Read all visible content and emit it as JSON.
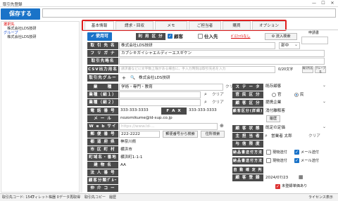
{
  "window": {
    "title": "取引先登録",
    "minimize": "—",
    "maximize": "☐",
    "close": "✕"
  },
  "toolbar": {
    "save_label": "保存する"
  },
  "tree": {
    "items": [
      {
        "label": "選択先",
        "color": "red"
      },
      {
        "label": "　株式会社LDS技研",
        "color": "black"
      },
      {
        "label": "グループ",
        "color": "blue"
      },
      {
        "label": "　株式会社LDS技研",
        "color": "black"
      }
    ]
  },
  "tabs": [
    "基本情報",
    "請求・回収",
    "メモ",
    "ご担当者",
    "購買",
    "オプション"
  ],
  "form": {
    "status_btn": "使用可",
    "usage_label": "利 用 区 分",
    "customer_label": "顧客",
    "supplier_label": "仕入先",
    "profile_link": "ｶﾞﾛﾌｧｲﾙなし",
    "tail_search": "流入検索",
    "request_label": "申請書",
    "name_label": "取 引 先 名",
    "name_value": "株式会社LDS技研",
    "dept_value": "部中",
    "kana_label": "フ リ ガ ナ",
    "kana_value": "カブシキガイシャエルディーエスギケン",
    "abbr_label": "取引先略名",
    "csv_label": "CSV出力用名",
    "csv_placeholder": "請求書などに文字数上限がある場合に、手入力時刻は取引先名を入力",
    "csv_count": "0/20文字",
    "copy_btn1": "取引先名",
    "copy_btn2": "グループ名",
    "group_label": "取引先グループ",
    "group_plus": "+",
    "group_value": "株式会社LDS技研",
    "industry_label": "業　　種",
    "industry_value": "学術・専門・教育",
    "industry_sub1": "業種（細１）",
    "industry_sub2": "業種（細２）",
    "clear": "クリア",
    "phone_label": "電 話 番 号",
    "phone_value": "333-333-3333",
    "fax_label": "F A X",
    "fax_value": "333-333-3333",
    "mail_label": "メ ー ル",
    "mail_value": "nozomikume@ld-sup.co.jp",
    "web_label": "W e b サイト",
    "web_value": "https://www.ld-...",
    "zip_label": "郵 便 番 号",
    "zip_value": "222-2222",
    "zip_btn": "郵便番号から検索",
    "addr_btn": "住所検索",
    "pref_label": "都 道 府 県",
    "pref_value": "神奈川県",
    "city_label": "市 区 町 村",
    "city_value": "横浜市",
    "street_label": "町域名・番地",
    "street_value": "横浜町1-1-1",
    "building_label": "建 物 名",
    "building_value": "AA",
    "person_label": "法 人 番 号",
    "invoice_label": "顧客分類ｸﾞﾙｰﾌﾟ",
    "extra_label": "仲 介 コ ー ド",
    "status_label": "ス テ ー タ ス",
    "status_value": "既存顧客",
    "ownership_label": "官 民 区 分",
    "gov_label": "官",
    "civ_label": "民",
    "segment_label": "顧 客 区 分",
    "segment_value": "提携企業",
    "segment2_label": "顧客区分(詳細)",
    "segment2_value": "消付離販客",
    "segment2_btn": "履歴",
    "contract_label": "顧 客 状 態",
    "contract_value": "既定の定価",
    "rep_label": "主 担 当 者",
    "rep_value": "営業者 太郎",
    "billing_label": "与 信 限 度 額",
    "send_label": "納品書送付方法",
    "send_label2": "納品書送付方法",
    "send_opt1": "現物送付",
    "send_opt2": "メール送付",
    "card_label": "自 動 確 定 判 定",
    "date_label": "顧 客 登 録 日",
    "date_value": "2024/07/23",
    "flag_label": "未登録単価あり"
  },
  "statusbar": {
    "code": "取引先コード: 1547",
    "window": "ウィレット株器 0",
    "data": "データ再取得",
    "copy": "取引先コピー",
    "history": "履歴",
    "license": "ライセンス表示"
  }
}
